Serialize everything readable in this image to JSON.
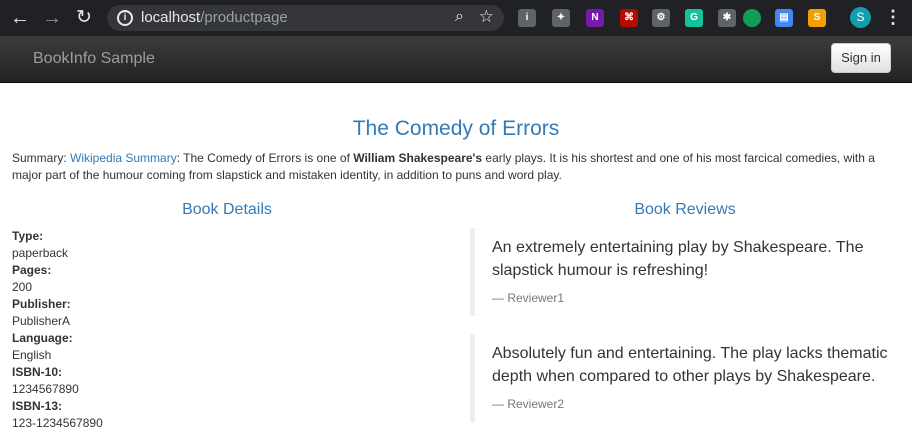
{
  "browser": {
    "url_host": "localhost",
    "url_path": "/productpage",
    "avatar_letter": "S",
    "extensions": [
      {
        "name": "instapaper-extension-icon",
        "glyph": "i",
        "color": "#5f6368"
      },
      {
        "name": "lightbulb-extension-icon",
        "glyph": "✦",
        "color": "#5f6368"
      },
      {
        "name": "onenote-extension-icon",
        "glyph": "N",
        "color": "#7719aa"
      },
      {
        "name": "pdf-extension-icon",
        "glyph": "⌘",
        "color": "#b30b00"
      },
      {
        "name": "gear-extension-icon",
        "glyph": "⚙",
        "color": "#5f6368"
      },
      {
        "name": "grammarly-extension-icon",
        "glyph": "G",
        "color": "#15c39a"
      },
      {
        "name": "bulb-extension-icon",
        "glyph": "✱",
        "color": "#5f6368"
      },
      {
        "name": "green-dot-extension-icon",
        "glyph": "",
        "color": "#0f9d58"
      },
      {
        "name": "document-extension-icon",
        "glyph": "▤",
        "color": "#4285f4"
      },
      {
        "name": "sublime-extension-icon",
        "glyph": "S",
        "color": "#f4a100"
      }
    ]
  },
  "app": {
    "brand": "BookInfo Sample",
    "signin_label": "Sign in"
  },
  "book": {
    "title": "The Comedy of Errors",
    "summary_label": "Summary: ",
    "summary_link": "Wikipedia Summary",
    "summary_text_1": ": The Comedy of Errors is one of ",
    "summary_bold": "William Shakespeare's",
    "summary_text_2": " early plays. It is his shortest and one of his most farcical comedies, with a major part of the humour coming from slapstick and mistaken identity, in addition to puns and word play."
  },
  "details": {
    "heading": "Book Details",
    "type_label": "Type:",
    "type_value": "paperback",
    "pages_label": "Pages:",
    "pages_value": "200",
    "publisher_label": "Publisher:",
    "publisher_value": "PublisherA",
    "language_label": "Language:",
    "language_value": "English",
    "isbn10_label": "ISBN-10:",
    "isbn10_value": "1234567890",
    "isbn13_label": "ISBN-13:",
    "isbn13_value": "123-1234567890"
  },
  "reviews": {
    "heading": "Book Reviews",
    "items": [
      {
        "text": "An extremely entertaining play by Shakespeare. The slapstick humour is refreshing!",
        "reviewer": "— Reviewer1"
      },
      {
        "text": "Absolutely fun and entertaining. The play lacks thematic depth when compared to other plays by Shakespeare.",
        "reviewer": "— Reviewer2"
      }
    ]
  }
}
